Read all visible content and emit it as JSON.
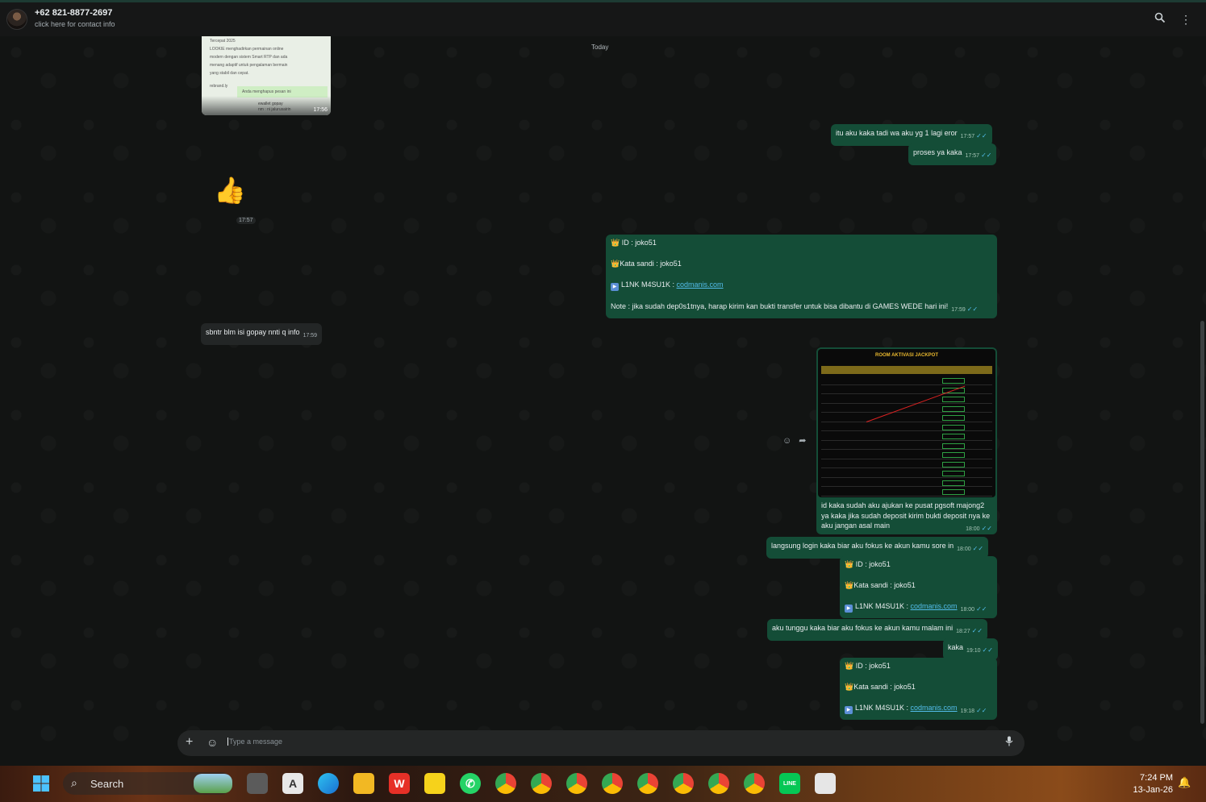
{
  "header": {
    "contact_name": "+62 821-8877-2697",
    "contact_sub": "click here for contact info",
    "search_icon": "search-icon",
    "menu_icon": "kebab-menu-icon"
  },
  "chat": {
    "date_chip": "Today",
    "preview_time": "17:56",
    "preview_lines": [
      "Tercepat 2025",
      "LOOKIE menghadirkan permainan online",
      "modern dengan sistem Smart RTP dan ada",
      "menang adaptif untuk pengalaman bermain",
      "yang stabil dan cepat.",
      "rebrand.ly",
      "Anda menghapus pesan ini",
      "ewallet gopay",
      "nm : ni  jalurusairin"
    ],
    "thumbs_up_emoji": "👍",
    "thumbs_up_time": "17:57",
    "msg1": {
      "text": "itu aku kaka tadi wa aku yg 1 lagi eror",
      "time": "17:57"
    },
    "msg2": {
      "text": "proses ya kaka",
      "time": "17:57"
    },
    "msg3": {
      "id_line": " ID :  joko51",
      "pass_line": "Kata sandi : joko51",
      "link_label": "L1NK M4SU1K : ",
      "link": "codmanis.com",
      "note": "Note : jika sudah dep0s1tnya, harap kirim kan bukti transfer untuk bisa dibantu di GAMES WEDE hari ini!",
      "time": "17:59"
    },
    "msg_in": {
      "text": "sbntr blm isi gopay nnti q info",
      "time": "17:59"
    },
    "image_msg": {
      "image_title": "ROOM AKTIVASI JACKPOT",
      "caption": "id kaka sudah aku ajukan ke pusat pgsoft majong2 ya kaka jika sudah deposit kirim bukti deposit nya ke aku jangan asal main",
      "time": "18:00"
    },
    "msg4": {
      "text": "langsung login kaka biar aku fokus ke akun kamu sore in",
      "time": "18:00"
    },
    "msg5": {
      "id_line": " ID :  joko51",
      "pass_line": "Kata sandi : joko51",
      "link_label": "L1NK M4SU1K : ",
      "link": "codmanis.com",
      "time": "18:00"
    },
    "msg6": {
      "text": "aku tunggu kaka biar aku fokus ke akun kamu malam ini",
      "time": "18:27"
    },
    "msg7": {
      "text": "kaka",
      "time": "19:10"
    },
    "msg8": {
      "id_line": " ID :  joko51",
      "pass_line": "Kata sandi : joko51",
      "link_label": "L1NK M4SU1K : ",
      "link": "codmanis.com",
      "time": "19:18"
    },
    "ticks": "✓✓"
  },
  "composer": {
    "placeholder": "Type a message"
  },
  "taskbar": {
    "search_label": "Search",
    "time": "7:24 PM",
    "date": "13-Jan-26"
  },
  "colors": {
    "outgoing_bubble": "#144d37",
    "incoming_bubble": "#232626",
    "link": "#53bdeb"
  }
}
